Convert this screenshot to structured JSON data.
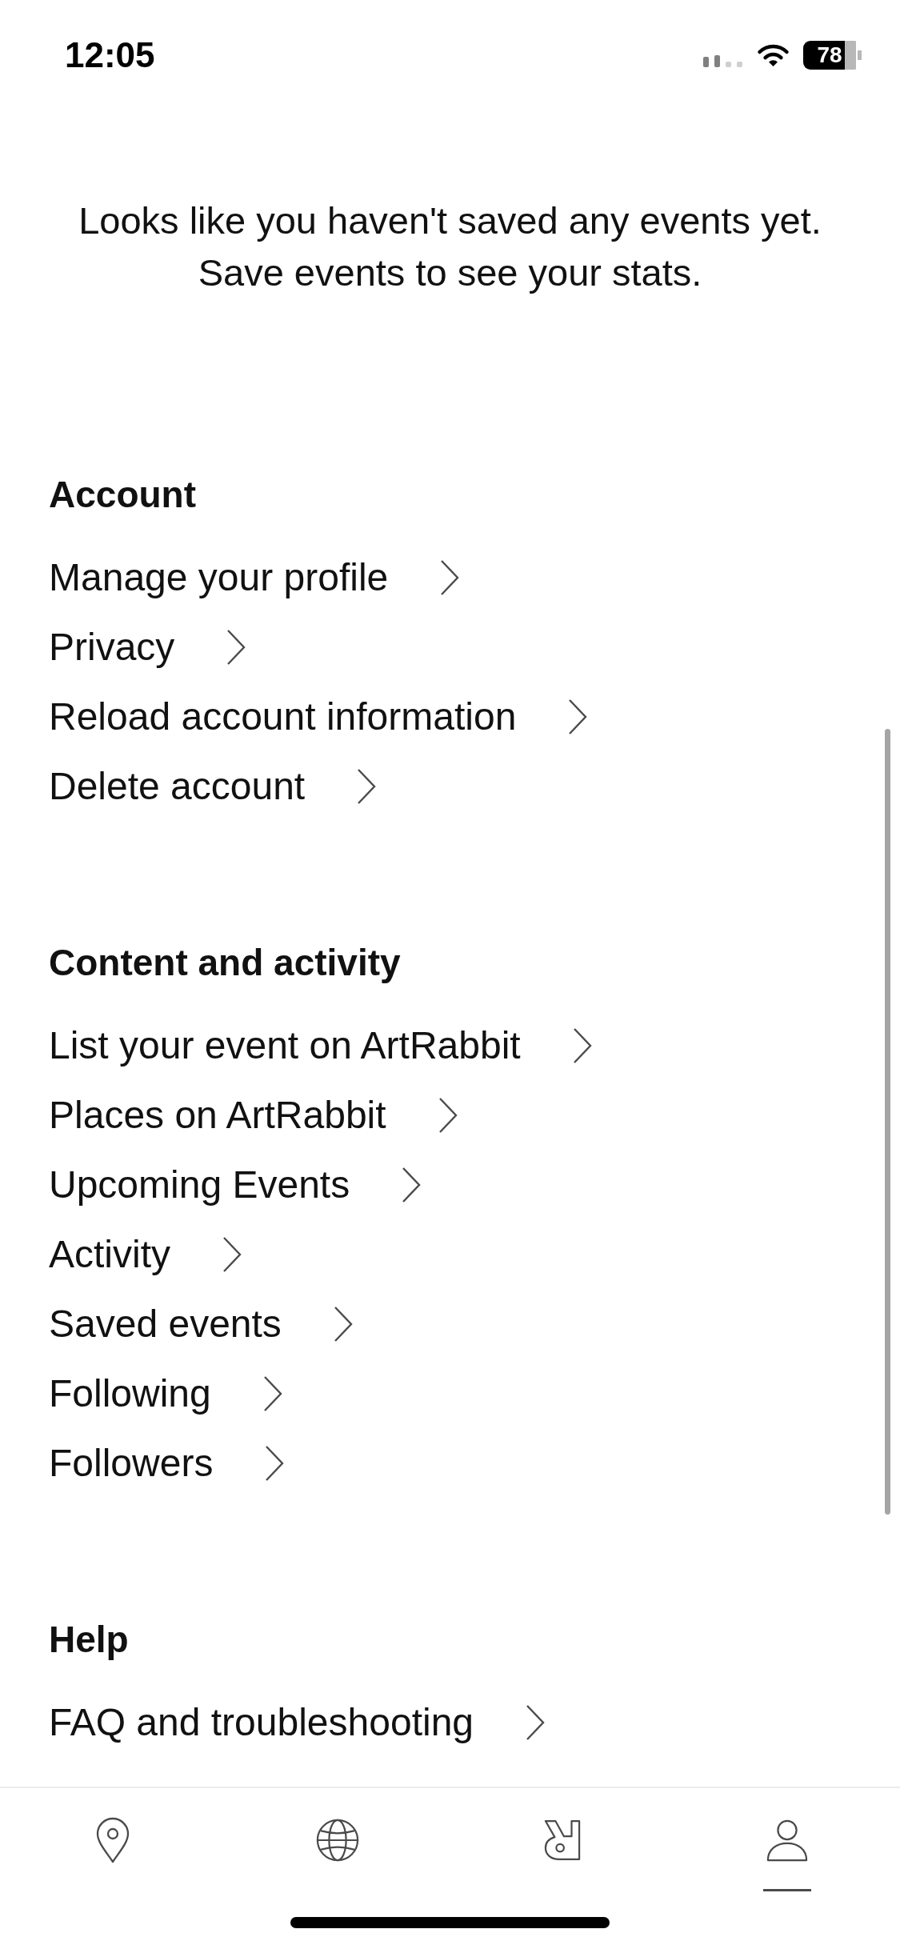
{
  "status_bar": {
    "time": "12:05",
    "battery": "78"
  },
  "message": "Looks like you haven't saved any events yet. Save events to see your stats.",
  "sections": [
    {
      "title": "Account",
      "items": [
        "Manage your profile",
        "Privacy",
        "Reload account information",
        "Delete account"
      ]
    },
    {
      "title": "Content and activity",
      "items": [
        "List your event on ArtRabbit",
        "Places on ArtRabbit",
        "Upcoming Events",
        "Activity",
        "Saved events",
        "Following",
        "Followers"
      ]
    },
    {
      "title": "Help",
      "items": [
        "FAQ and troubleshooting"
      ]
    }
  ],
  "tab_bar": [
    {
      "selected": false
    },
    {
      "selected": false
    },
    {
      "selected": false
    },
    {
      "selected": true
    }
  ]
}
